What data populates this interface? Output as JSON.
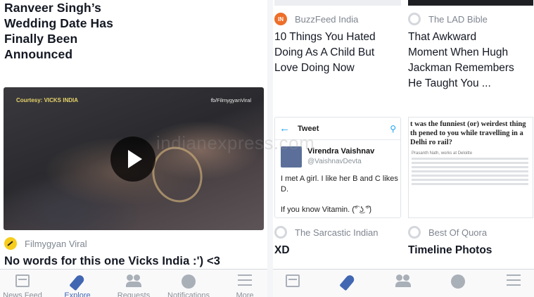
{
  "left_panel": {
    "top_story": {
      "headline": "Ranveer Singh's Wedding Date Has Finally Been Announced",
      "lines": [
        "Ranveer Singh’s",
        "Wedding Date Has",
        "Finally Been",
        "Announced"
      ]
    },
    "video_post": {
      "overlay_courtesy": "Courtesy: VICKS INDIA",
      "overlay_handle": "fb/FilmygyanViral",
      "source": "Filmygyan Viral",
      "headline": "No words for this one Vicks India :') <3"
    }
  },
  "right_panel": {
    "cards": [
      {
        "source": "BuzzFeed India",
        "source_icon_text": "IN",
        "headline_lines": [
          "10 Things You Hated",
          "Doing As A Child But",
          "Love Doing Now"
        ]
      },
      {
        "source": "The LAD Bible",
        "headline_lines": [
          "That Awkward",
          "Moment When Hugh",
          "Jackman Remembers",
          "He Taught You ..."
        ]
      },
      {
        "source": "The Sarcastic Indian",
        "headline": "XD"
      },
      {
        "source": "Best Of Quora",
        "headline": "Timeline Photos"
      }
    ],
    "tweet_thumb": {
      "bar_title": "Tweet",
      "name": "Virendra Vaishnav",
      "handle": "@VaishnavDevta",
      "text_line1": "I met A girl. I like her B and C likes D.",
      "text_line2": "If you know Vitamin. (͡° ͜ʖ ͡°)"
    },
    "quora_thumb": {
      "title": "t was the funniest (or) weirdest thing th pened to you while travelling in a Delhi ro rail?",
      "author": "Prasanth Nath, works at Deloitte"
    }
  },
  "watermark": "indianexpress.com",
  "tabbar": {
    "tabs": [
      {
        "label": "News Feed",
        "icon": "news-feed-icon"
      },
      {
        "label": "Explore",
        "icon": "rocket-icon",
        "active": true
      },
      {
        "label": "Requests",
        "icon": "people-icon"
      },
      {
        "label": "Notifications",
        "icon": "globe-icon"
      },
      {
        "label": "More",
        "icon": "menu-icon"
      }
    ]
  },
  "colors": {
    "accent": "#4267b2",
    "text": "#141823",
    "muted": "#7f8690",
    "buzzfeed": "#ee6e29",
    "filmygyan": "#f7cd1b"
  }
}
